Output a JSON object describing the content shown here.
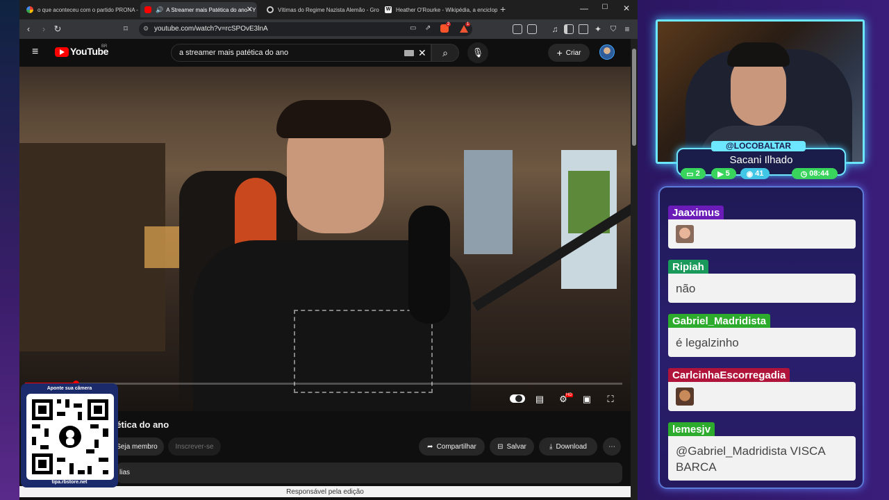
{
  "browser": {
    "tabs": [
      {
        "title": "o que aconteceu com o partido PRONA - Pe",
        "icon": "google-icon"
      },
      {
        "title": "A Streamer mais Patética do ano - Y",
        "icon": "youtube-icon",
        "active": true
      },
      {
        "title": "Vítimas do Regime Nazista Alemão - Grok",
        "icon": "grok-icon"
      },
      {
        "title": "Heather O'Rourke - Wikipédia, a enciclopédi",
        "icon": "wikipedia-icon"
      }
    ],
    "new_tab": "+",
    "url": "youtube.com/watch?v=rcSPOvE3lnA",
    "ext_badge_1": "2",
    "ext_badge_2": "1"
  },
  "youtube": {
    "logo_text": "YouTube",
    "country_code": "BR",
    "search_query": "a streamer mais patética do ano",
    "create_label": "Criar",
    "video_title_partial": "tética do ano",
    "join_label": "Seja membro",
    "subscribe_label": "Inscrever-se",
    "share_label": "Compartilhar",
    "save_label": "Salvar",
    "download_label": "Download",
    "more_label": "⋯",
    "desc_partial": "lias",
    "footer": "Responsável pela edição",
    "settings_badge": "HD",
    "progress": 0.085
  },
  "qr_overlay": {
    "top_text": "Aponte sua câmera",
    "url": "tipa.rbstore.net"
  },
  "streamer": {
    "handle": "@LOCOBALTAR",
    "subtitle": "Sacani Ilhado",
    "stats": [
      {
        "icon": "chat-icon",
        "value": "2",
        "color": "#39d45c"
      },
      {
        "icon": "youtube-icon",
        "value": "5",
        "color": "#39d45c"
      },
      {
        "icon": "discord-icon",
        "value": "41",
        "color": "#41c6e6"
      },
      {
        "icon": "clock-icon",
        "value": "08:44",
        "color": "#39d45c"
      }
    ]
  },
  "chat": {
    "messages": [
      {
        "user": "Jaaximus",
        "color": "#6a1bb8",
        "text": "",
        "emote": true
      },
      {
        "user": "Ripiah",
        "color": "#1a9a5a",
        "text": "não",
        "emote": false
      },
      {
        "user": "Gabriel_Madridista",
        "color": "#2cab2c",
        "text": "é legalzinho",
        "emote": false
      },
      {
        "user": "CarlcinhaEscorregadia",
        "color": "#b0143a",
        "text": "",
        "emote": true
      },
      {
        "user": "lemesjv",
        "color": "#2cab2c",
        "text": "@Gabriel_Madridista VISCA BARCA",
        "emote": false
      }
    ]
  }
}
